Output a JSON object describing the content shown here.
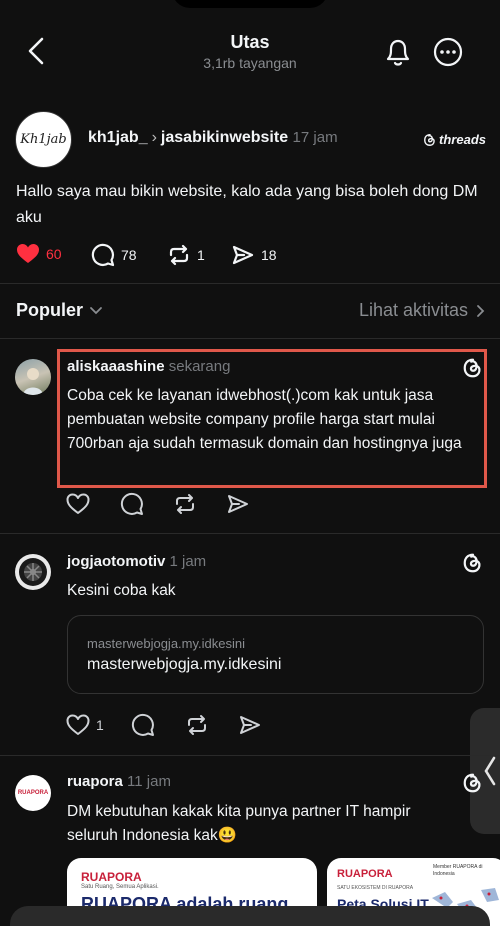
{
  "header": {
    "title": "Utas",
    "views": "3,1rb tayangan"
  },
  "post": {
    "avatar_text": "Kh1jab",
    "author": "kh1jab_",
    "tagged": "jasabikinwebsite",
    "time": "17 jam",
    "brand": "threads",
    "text": "Hallo saya mau bikin website, kalo ada yang bisa boleh dong DM aku",
    "likes": "60",
    "replies": "78",
    "reposts": "1",
    "shares": "18",
    "like_color": "#ff3040"
  },
  "filter": {
    "label": "Populer",
    "activity": "Lihat aktivitas"
  },
  "comments": [
    {
      "user": "aliskaaashine",
      "time": "sekarang",
      "text": "Coba cek ke layanan idwebhost(.)com kak untuk jasa pembuatan website company profile harga start mulai 700rban aja sudah termasuk domain dan hostingnya juga"
    },
    {
      "user": "jogjaotomotiv",
      "time": "1 jam",
      "text": "Kesini coba kak",
      "link_small": "masterwebjogja.my.idkesini",
      "link_big": "masterwebjogja.my.idkesini",
      "likes": "1"
    },
    {
      "user": "ruapora",
      "time": "11 jam",
      "text": "DM kebutuhan kakak kita punya partner IT hampir seluruh Indonesia kak😃",
      "avatar_text": "RUAPORA",
      "preview1_brand": "RUAPORA",
      "preview1_tag": "Satu Ruang, Semua Aplikasi.",
      "preview1_headline": "RUAPORA adalah ruang",
      "preview2_brand": "RUAPORA",
      "preview2_sub": "SATU EKOSISTEM DI RUAPORA",
      "preview2_headline": "Peta Solusi IT",
      "preview2_map_title": "Member RUAPORA di Indonesia"
    }
  ],
  "colors": {
    "highlight": "#e0584a",
    "background": "#101010"
  }
}
